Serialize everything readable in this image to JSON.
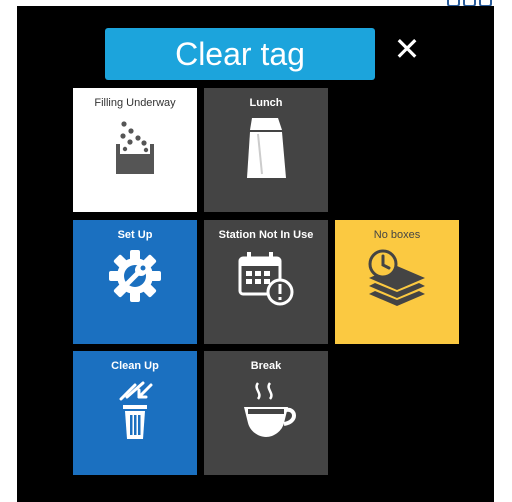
{
  "header": {
    "clear_tag_label": "Clear tag",
    "close_glyph": "✕"
  },
  "tiles": [
    {
      "label": "Filling Underway",
      "icon": "filling-bin-icon",
      "color": "#ffffff"
    },
    {
      "label": "Lunch",
      "icon": "lunch-bag-icon",
      "color": "#444444"
    },
    {
      "label": "Set Up",
      "icon": "wrench-gear-icon",
      "color": "#1b70c0"
    },
    {
      "label": "Station Not In Use",
      "icon": "calendar-alert-icon",
      "color": "#444444"
    },
    {
      "label": "No boxes",
      "icon": "clock-stack-icon",
      "color": "#fbc941"
    },
    {
      "label": "Clean Up",
      "icon": "trash-icon",
      "color": "#1b70c0"
    },
    {
      "label": "Break",
      "icon": "coffee-cup-icon",
      "color": "#444444"
    }
  ],
  "colors": {
    "accent": "#1ca4dc",
    "panel": "#000000"
  }
}
